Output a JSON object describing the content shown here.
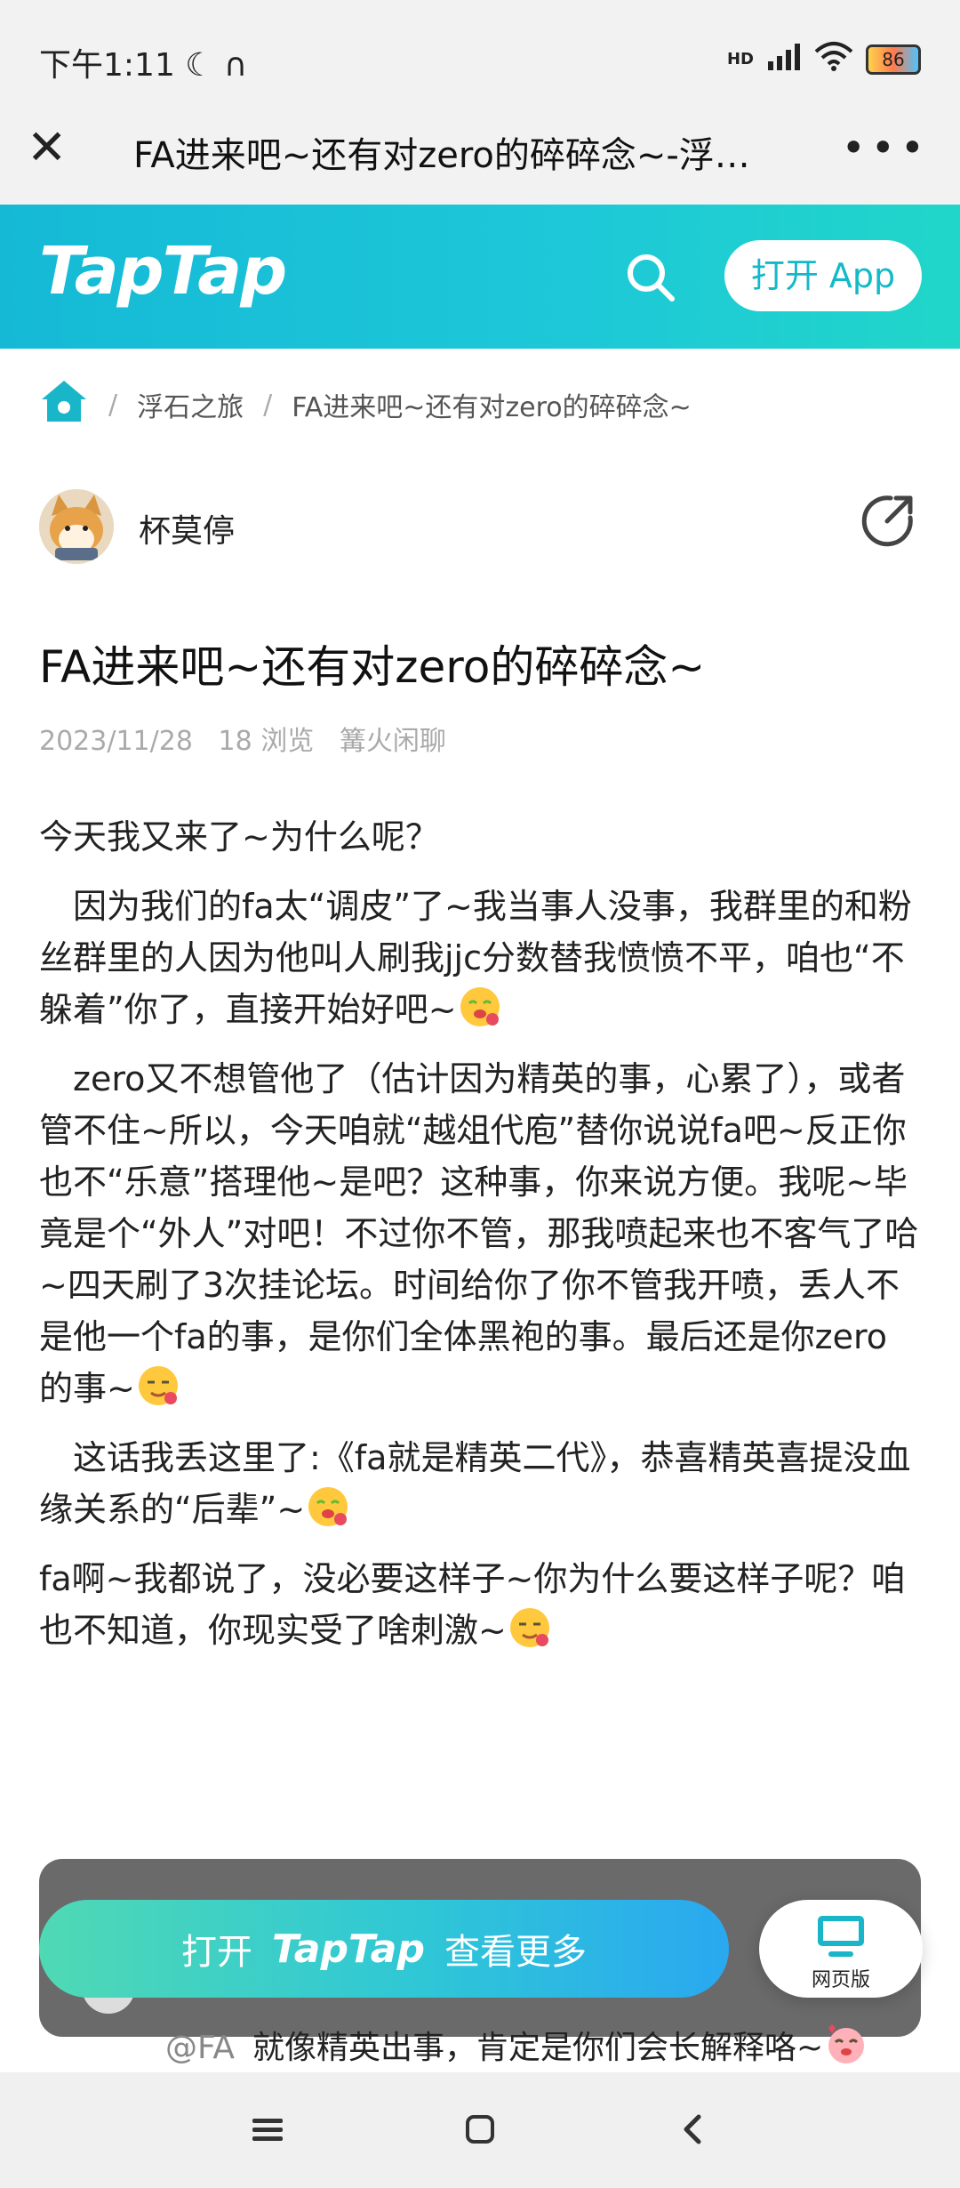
{
  "status_bar": {
    "time": "下午1:11",
    "network": "HD",
    "battery": "86"
  },
  "window": {
    "title": "FA进来吧~还有对zero的碎碎念~-浮…",
    "close_icon": "close-icon",
    "more_icon": "more-dots-icon"
  },
  "header": {
    "logo": "TapTap",
    "open_app": "打开 App",
    "brand_color": "#1ec8d8"
  },
  "breadcrumb": {
    "items": [
      "浮石之旅",
      "FA进来吧~还有对zero的碎碎念~"
    ]
  },
  "author": {
    "name": "杯莫停"
  },
  "post": {
    "title": "FA进来吧~还有对zero的碎碎念~",
    "date": "2023/11/28",
    "views": "18 浏览",
    "category": "篝火闲聊",
    "paragraphs": [
      "今天我又来了~为什么呢？",
      "　因为我们的fa太“调皮”了~我当事人没事，我群里的和粉丝群里的人因为他叫人刷我jjc分数替我愤愤不平，咱也“不躲着”你了，直接开始好吧~",
      "　zero又不想管他了（估计因为精英的事，心累了），或者管不住~所以，今天咱就“越俎代庖”替你说说fa吧~反正你也不“乐意”搭理他~是吧？这种事，你来说方便。我呢~毕竟是个“外人”对吧！不过你不管，那我喷起来也不客气了哈~四天刷了3次挂论坛。时间给你了你不管我开喷，丢人不是他一个fa的事，是你们全体黑袍的事。最后还是你zero的事~",
      "　这话我丢这里了:《fa就是精英二代》，恭喜精英喜提没血缘关系的“后辈”~",
      " fa啊~我都说了，没必要这样子~你为什么要这样子呢？咱也不知道，你现实受了啥刺激~"
    ]
  },
  "bottom": {
    "open_prefix": "打开",
    "open_brand": "TapTap",
    "open_suffix": "查看更多",
    "web_version": "网页版",
    "comment_at": "@FA",
    "comment_text": "就像精英出事，肯定是你们会长解释咯~"
  }
}
